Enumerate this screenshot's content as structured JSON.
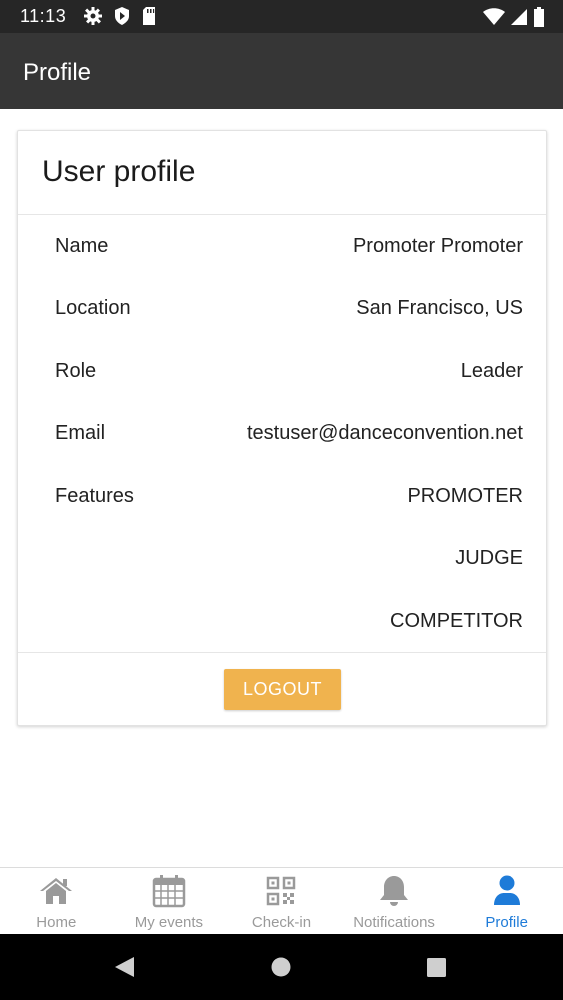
{
  "status_bar": {
    "time": "11:13",
    "left_icons": [
      "gear-icon",
      "shield-icon",
      "sd-card-icon"
    ],
    "right_icons": [
      "wifi-icon",
      "signal-icon",
      "battery-icon"
    ]
  },
  "app_bar": {
    "title": "Profile"
  },
  "card": {
    "title": "User profile",
    "rows": [
      {
        "label": "Name",
        "value": "Promoter Promoter"
      },
      {
        "label": "Location",
        "value": "San Francisco, US"
      },
      {
        "label": "Role",
        "value": "Leader"
      },
      {
        "label": "Email",
        "value": "testuser@danceconvention.net"
      },
      {
        "label": "Features",
        "value": "PROMOTER"
      },
      {
        "label": "",
        "value": "JUDGE"
      },
      {
        "label": "",
        "value": "COMPETITOR"
      }
    ],
    "logout_label": "LOGOUT"
  },
  "bottom_nav": {
    "items": [
      {
        "label": "Home",
        "icon": "home-icon",
        "active": false
      },
      {
        "label": "My events",
        "icon": "calendar-icon",
        "active": false
      },
      {
        "label": "Check-in",
        "icon": "qr-code-icon",
        "active": false
      },
      {
        "label": "Notifications",
        "icon": "bell-icon",
        "active": false
      },
      {
        "label": "Profile",
        "icon": "user-icon",
        "active": true
      }
    ]
  },
  "colors": {
    "accent": "#1e7bd8",
    "logout_button": "#f0b34e",
    "app_bar": "#363636",
    "status_bar": "#262626",
    "inactive_nav": "#9a9a9a"
  }
}
